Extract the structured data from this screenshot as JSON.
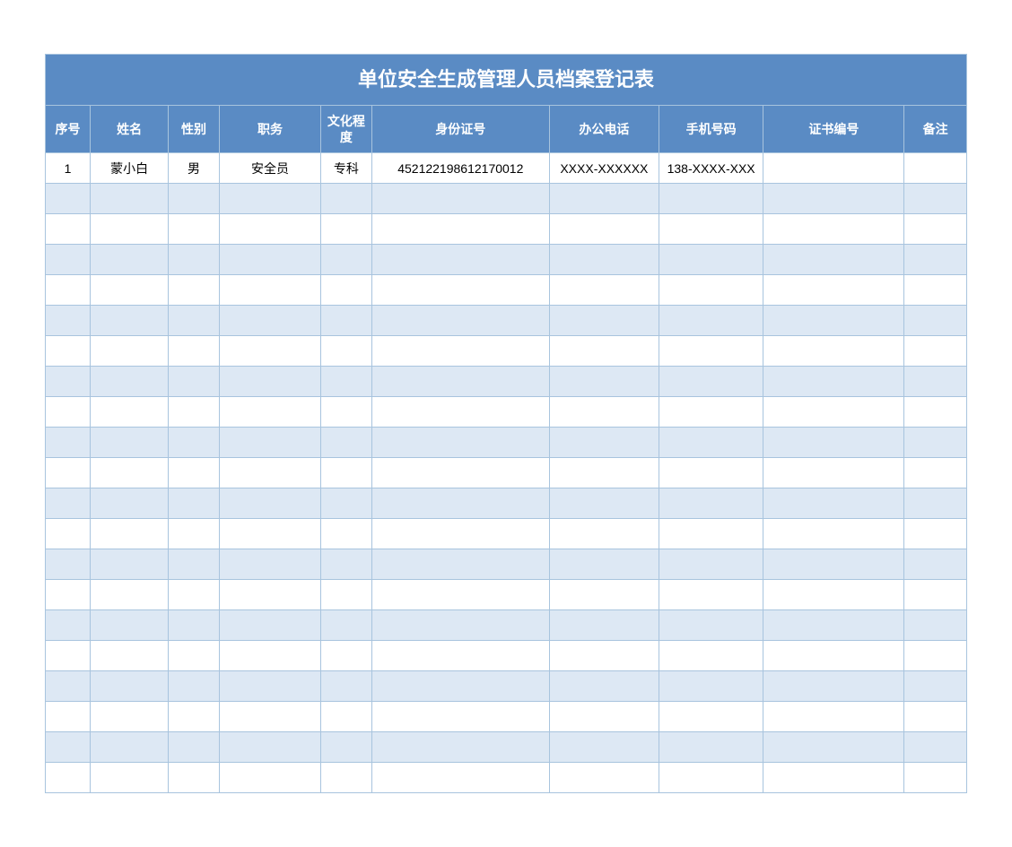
{
  "title": "单位安全生成管理人员档案登记表",
  "columns": [
    "序号",
    "姓名",
    "性别",
    "职务",
    "文化程度",
    "身份证号",
    "办公电话",
    "手机号码",
    "证书编号",
    "备注"
  ],
  "rows": [
    {
      "seq": "1",
      "name": "蒙小白",
      "gender": "男",
      "position": "安全员",
      "education": "专科",
      "idnum": "452122198612170012",
      "office": "XXXX-XXXXXX",
      "mobile": "138-XXXX-XXX",
      "cert": "",
      "remark": ""
    }
  ],
  "empty_row_count": 20
}
